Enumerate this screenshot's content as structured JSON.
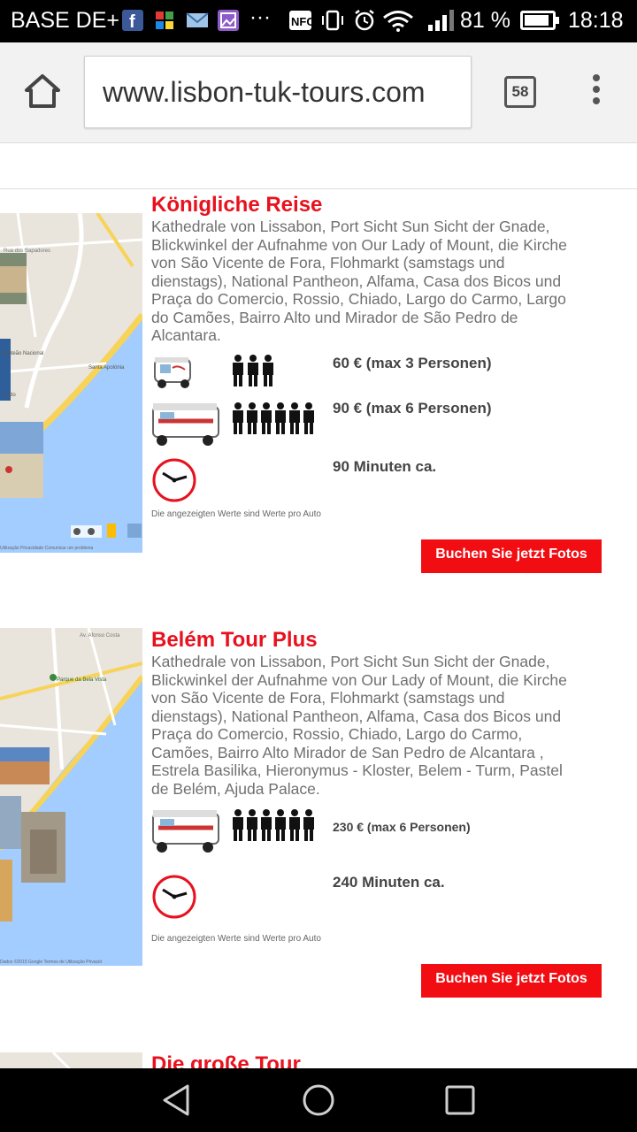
{
  "status_bar": {
    "carrier": "BASE DE+",
    "battery_percent": "81 %",
    "time": "18:18",
    "icons": [
      "facebook-icon",
      "puzzle-icon",
      "mail-icon",
      "gallery-icon",
      "more-dots-icon",
      "nfc-icon",
      "vibrate-icon",
      "alarm-icon",
      "wifi-icon",
      "signal-icon",
      "battery-icon"
    ],
    "dots": "···"
  },
  "browser": {
    "url": "www.lisbon-tuk-tours.com",
    "tab_count": "58"
  },
  "tours": [
    {
      "title": "Königliche Reise",
      "description": "Kathedrale von Lissabon, Port Sicht Sun Sicht der Gnade, Blickwinkel der Aufnahme von Our Lady of Mount, die Kirche von São Vicente de Fora, Flohmarkt (samstags und dienstags), National Pantheon, Alfama, Casa dos Bicos und Praça do Comercio, Rossio, Chiado, Largo do Carmo, Largo do Camões, Bairro Alto und Mirador de São Pedro de Alcantara.",
      "price_small": "60 € (max 3 Personen)",
      "price_large": "90 € (max 6 Personen)",
      "duration": "90 Minuten ca.",
      "note": "Die angezeigten Werte sind Werte pro Auto",
      "book_label": "Buchen Sie jetzt Fotos",
      "map_labels": [
        "Rua dos Sapadores",
        "Panteão Nacional",
        "Santa Apolónia",
        "Fado",
        "Av. Infante D. Henrique",
        "Utilização",
        "Privacidade",
        "Comunicar um problema",
        "Mundo - Terreno"
      ]
    },
    {
      "title": "Belém Tour Plus",
      "description": "Kathedrale von Lissabon, Port Sicht Sun Sicht der Gnade, Blickwinkel der Aufnahme von Our Lady of Mount, die Kirche von São Vicente de Fora, Flohmarkt (samstags und dienstags), National Pantheon, Alfama, Casa dos Bicos und Praça do Comercio, Rossio, Chiado, Largo do Carmo, Camões, Bairro Alto Mirador de San Pedro de Alcantara , Estrela Basilika, Hieronymus - Kloster, Belem - Turm, Pastel de Belém, Ajuda Palace.",
      "price_large": "230 € (max 6 Personen)",
      "duration": "240 Minuten ca.",
      "note": "Die angezeigten Werte sind Werte pro Auto",
      "book_label": "Buchen Sie jetzt Fotos",
      "map_labels": [
        "Av. Brasil",
        "Av. Afonso Costa",
        "Parque da Bela Vista",
        "Av. Gago Coutinho",
        "Av. Infante Dom Henrique",
        "©2015 Google",
        "Termos de Utilização",
        "Privacid"
      ]
    },
    {
      "title": "Die große Tour"
    }
  ],
  "nav_bar": {
    "icons": [
      "back-icon",
      "home-icon",
      "recents-icon"
    ]
  }
}
